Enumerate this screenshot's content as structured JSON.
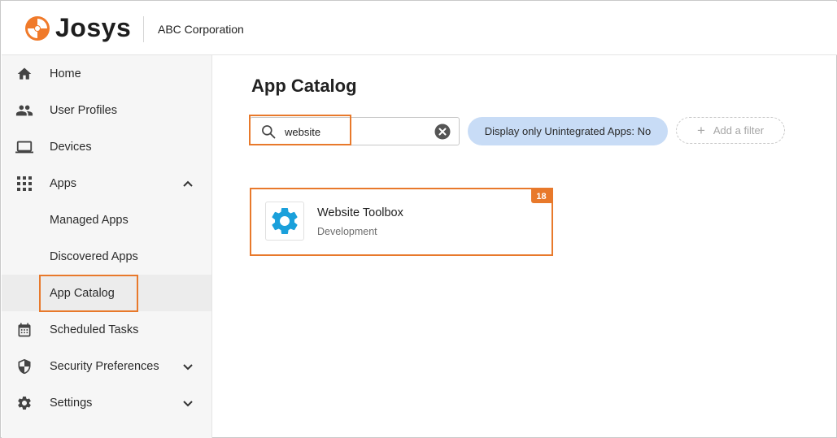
{
  "header": {
    "brand": "Josys",
    "organization": "ABC Corporation"
  },
  "sidebar": {
    "items": [
      {
        "label": "Home",
        "icon": "home-icon"
      },
      {
        "label": "User Profiles",
        "icon": "users-icon"
      },
      {
        "label": "Devices",
        "icon": "laptop-icon"
      },
      {
        "label": "Apps",
        "icon": "grid-icon",
        "expanded": true
      },
      {
        "label": "Managed Apps"
      },
      {
        "label": "Discovered Apps"
      },
      {
        "label": "App Catalog",
        "active": true
      },
      {
        "label": "Scheduled Tasks",
        "icon": "calendar-icon"
      },
      {
        "label": "Security Preferences",
        "icon": "shield-icon",
        "expanded": false
      },
      {
        "label": "Settings",
        "icon": "gear-icon",
        "expanded": false
      }
    ]
  },
  "main": {
    "title": "App Catalog",
    "search": {
      "value": "website",
      "placeholder": ""
    },
    "filter_chip": "Display only Unintegrated Apps: No",
    "add_filter": "Add a filter",
    "apps": [
      {
        "name": "Website Toolbox",
        "category": "Development",
        "icon": "gear-icon",
        "badge": "18"
      }
    ]
  },
  "colors": {
    "accent_orange": "#e8792b",
    "chip_blue": "#c8dcf6",
    "app_icon_blue": "#1aa0db"
  }
}
